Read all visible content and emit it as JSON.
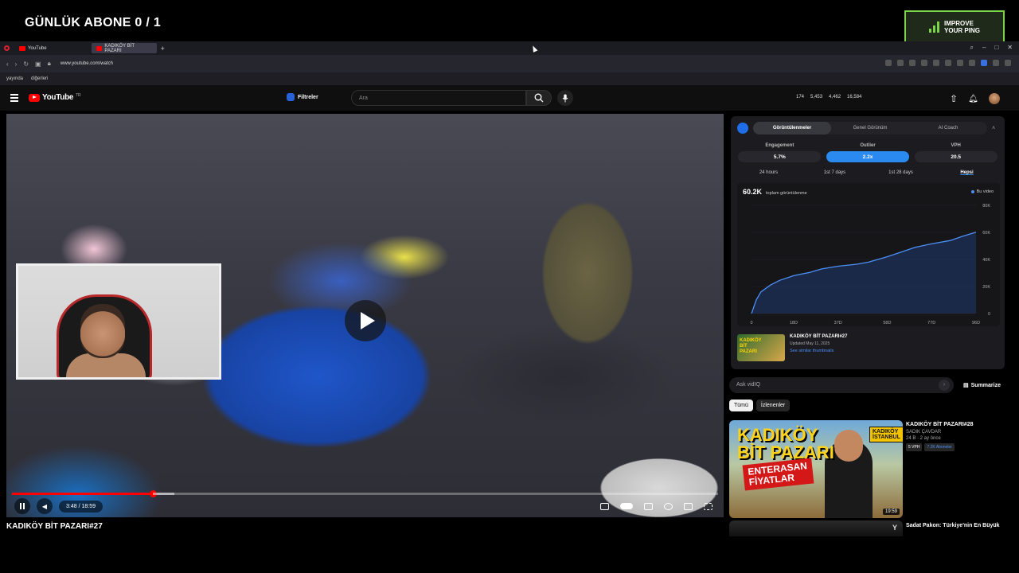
{
  "overlay": {
    "title": "GÜNLÜK ABONE 0 / 1",
    "ping_badge": {
      "line1": "IMPROVE",
      "line2": "YOUR PING",
      "color": "#7bd34a"
    }
  },
  "browser": {
    "tabs": [
      {
        "label": "YouTube",
        "active": false
      },
      {
        "label": "KADIKÖY BİT PAZARI",
        "active": true
      }
    ],
    "url": "www.youtube.com/watch",
    "bookmarks": [
      "yayında",
      "diğerleri"
    ]
  },
  "youtube": {
    "logo": "YouTube",
    "logo_suffix": "TR",
    "filters_label": "Filtreler",
    "search_placeholder": "Ara",
    "stats": [
      "174",
      "5,453",
      "4,462",
      "16,584"
    ]
  },
  "video": {
    "title": "KADIKÖY BİT PAZARI#27",
    "time": "3:48 / 18:59",
    "progress": 0.2
  },
  "vidiq": {
    "tabs": [
      "Görüntülenmeler",
      "Genel Görünüm",
      "AI Coach"
    ],
    "active_tab": 0,
    "metrics": [
      {
        "label": "Engagement",
        "value": "5.7%"
      },
      {
        "label": "Outlier",
        "value": "2.2x"
      },
      {
        "label": "VPH",
        "value": "20.5"
      }
    ],
    "ranges": [
      "24 hours",
      "1st 7 days",
      "1st 28 days",
      "Hepsi"
    ],
    "active_range": 3,
    "total_views": "60.2K",
    "total_label": "toplam görüntülenme",
    "legend": "Bu video",
    "related": {
      "title": "KADIKÖY BİT PAZARI#27",
      "updated": "Updated May 11, 2025",
      "link": "See similar thumbnails"
    }
  },
  "chart_data": {
    "type": "line",
    "title": "",
    "xlabel": "",
    "ylabel": "",
    "x_ticks": [
      "0",
      "18D",
      "37D",
      "58D",
      "77D",
      "96D"
    ],
    "y_ticks": [
      "0",
      "20K",
      "40K",
      "60K",
      "80K"
    ],
    "xlim": [
      0,
      96
    ],
    "ylim": [
      0,
      80000
    ],
    "series": [
      {
        "name": "Bu video",
        "x": [
          0,
          2,
          4,
          8,
          12,
          18,
          25,
          30,
          37,
          45,
          50,
          58,
          65,
          70,
          77,
          85,
          90,
          96
        ],
        "y": [
          0,
          10000,
          16000,
          21000,
          24500,
          28000,
          30500,
          33000,
          35000,
          36500,
          38000,
          42000,
          46000,
          49000,
          51500,
          54000,
          57000,
          60200
        ]
      }
    ],
    "colors": {
      "line": "#4d8ff5",
      "fill": "#1f3b6e"
    }
  },
  "askbar": {
    "placeholder": "Ask vidIQ",
    "summarize": "Summarize"
  },
  "chips": [
    "Tümü",
    "İzlenenler"
  ],
  "recommendations": [
    {
      "title": "KADIKÖY BİT PAZARI#28",
      "channel": "SADIK ÇAVDAR",
      "meta": "24 B · 2 ay önce",
      "tags": [
        "5 VPH",
        "7.2K Aboneler"
      ],
      "duration": "19:59",
      "thumb_text1": "KADIKÖY",
      "thumb_text2": "BİT PAZARI",
      "thumb_text3": "ENTERASAN",
      "thumb_text4": "FİYATLAR",
      "thumb_badge1": "KADIKÖY",
      "thumb_badge2": "İSTANBUL"
    },
    {
      "title": "Sadat Pakon: Türkiye'nin En Büyük",
      "logo": "Y"
    }
  ]
}
